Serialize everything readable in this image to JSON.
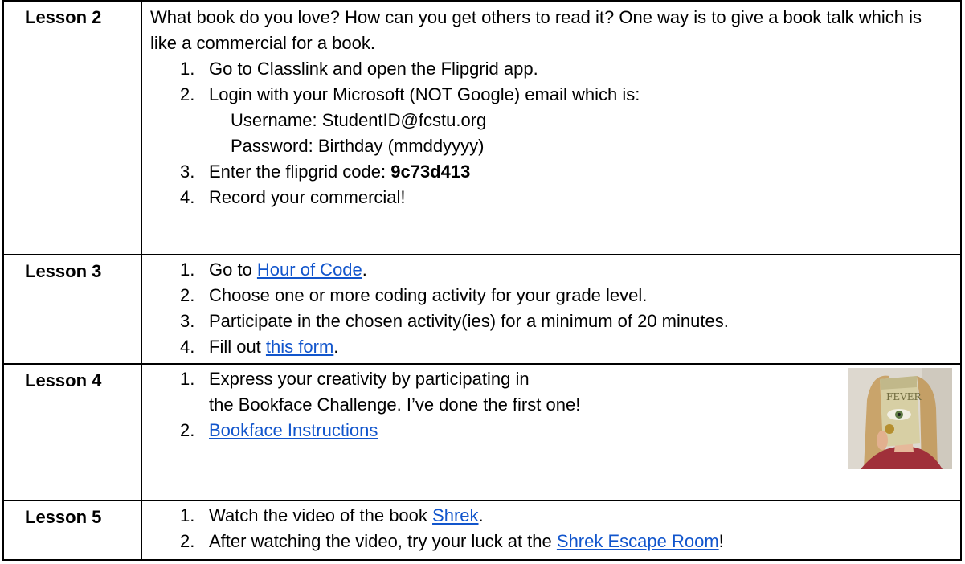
{
  "rows": [
    {
      "label": "Lesson 2",
      "intro": "What book do you love? How can you get others to read it? One way is to give a book talk which is like a commercial for a book.",
      "items": [
        {
          "num": "1.",
          "text": "Go to Classlink and open the Flipgrid app."
        },
        {
          "num": "2.",
          "text": "Login with your Microsoft (NOT Google) email which is:"
        },
        {
          "num": "3.",
          "text": "Enter the flipgrid code: ",
          "code": "9c73d413"
        },
        {
          "num": "4.",
          "text": "Record your commercial!"
        }
      ],
      "credentials": {
        "username": "Username: StudentID@fcstu.org",
        "password": "Password: Birthday (mmddyyyy)"
      }
    },
    {
      "label": "Lesson 3",
      "items": [
        {
          "num": "1.",
          "before": "Go to ",
          "link": "Hour of Code",
          "after": "."
        },
        {
          "num": "2.",
          "text": "Choose one or more coding activity for your grade level."
        },
        {
          "num": "3.",
          "text": "Participate in the chosen activity(ies) for a minimum of 20 minutes."
        },
        {
          "num": "4.",
          "before": "Fill out ",
          "link": "this form",
          "after": "."
        }
      ]
    },
    {
      "label": "Lesson 4",
      "items": [
        {
          "num": "1.",
          "line1": "Express your creativity by participating in",
          "line2": "the Bookface Challenge. I’ve done the first one!"
        },
        {
          "num": "2.",
          "link": "Bookface Instructions"
        }
      ],
      "photo_alt": "Bookface photo: person holding up book cover Fever 1793"
    },
    {
      "label": "Lesson 5",
      "items": [
        {
          "num": "1.",
          "before": "Watch the video of the book ",
          "link": "Shrek",
          "after": "."
        },
        {
          "num": "2.",
          "before": "After watching the video, try your luck at the ",
          "link": "Shrek Escape Room",
          "after": "!"
        }
      ]
    }
  ]
}
